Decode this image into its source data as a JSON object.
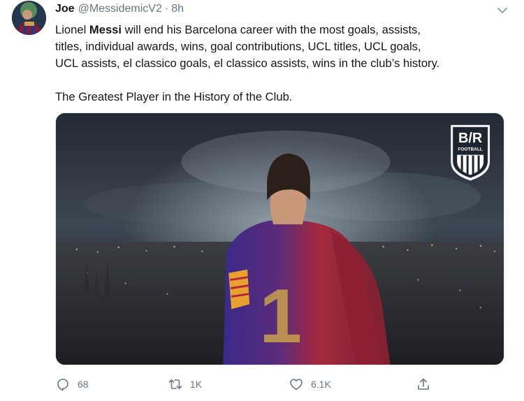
{
  "tweet": {
    "author_name": "Joe",
    "author_handle": "@MessidemicV2",
    "separator": "·",
    "time": "8h",
    "text_lines": [
      {
        "pre": "Lionel ",
        "bold": "Messi",
        "post": " will end his Barcelona career with the most goals, assists,"
      },
      {
        "text": "titles, individual awards, wins, goal contributions, UCL titles, UCL goals,"
      },
      {
        "text": "UCL assists, el classico goals, el classico assists, wins in the club’s history."
      },
      {
        "text": "The Greatest Player in the History of the Club."
      }
    ],
    "media": {
      "logo_text": "B/R",
      "logo_sub": "FOOTBALL",
      "jersey_number": "1"
    },
    "actions": {
      "reply_count": "68",
      "retweet_count": "1K",
      "like_count": "6.1K"
    }
  },
  "colors": {
    "text": "#14171a",
    "muted": "#657786",
    "border": "#e1e8ed"
  },
  "icons": [
    "chevron-down-icon",
    "reply-icon",
    "retweet-icon",
    "like-icon",
    "share-icon"
  ]
}
